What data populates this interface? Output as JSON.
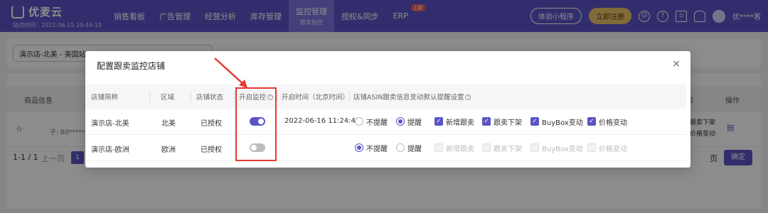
{
  "app": {
    "logo": "优麦云",
    "login_time": "站点时间：2022-06-15 20:44:10"
  },
  "nav": {
    "items": [
      {
        "label": "销售看板",
        "sub": ""
      },
      {
        "label": "广告管理",
        "sub": ""
      },
      {
        "label": "经营分析",
        "sub": ""
      },
      {
        "label": "库存管理",
        "sub": ""
      },
      {
        "label": "监控管理",
        "sub": "跟卖监控"
      },
      {
        "label": "授权&同步",
        "sub": ""
      },
      {
        "label": "ERP",
        "sub": "",
        "badge": "上新"
      }
    ],
    "mini_program": "体验小程序",
    "register": "立即注册",
    "username": "优****客"
  },
  "background": {
    "shop_select": "演示店-北美 - 美国站",
    "col_product": "商品信息",
    "col_action": "操作",
    "row_product_sub": "子: B0*****",
    "pager_text": "1-1 / 1",
    "pager_prev": "上一页",
    "pager_page": "1",
    "page_suffix": "页",
    "confirm": "确定",
    "right_col_a": "架",
    "right_col_b1": "跟卖下架",
    "right_col_b2": "价格变动"
  },
  "modal": {
    "title": "配置跟卖监控店铺",
    "close": "×",
    "headers": {
      "shop": "店铺简称",
      "region": "区域",
      "status": "店铺状态",
      "monitor": "开启监控",
      "start_time": "开启时间（北京时间）",
      "setting": "店铺ASIN跟卖信息变动默认提醒设置"
    },
    "options": {
      "no_remind": "不提醒",
      "remind": "提醒",
      "new_follow": "新增跟卖",
      "follow_off": "跟卖下架",
      "buybox": "BuyBox变动",
      "price": "价格变动"
    },
    "rows": [
      {
        "shop": "演示店-北美",
        "region": "北美",
        "status": "已授权",
        "monitor": "on",
        "start_time": "2022-06-16 11:24:47",
        "remind": "remind"
      },
      {
        "shop": "演示店-欧洲",
        "region": "欧洲",
        "status": "已授权",
        "monitor": "off",
        "start_time": "",
        "remind": "no_remind"
      }
    ]
  },
  "colors": {
    "primary": "#5b55c6",
    "highlight": "#e53935",
    "gold": "#e9c46a"
  }
}
